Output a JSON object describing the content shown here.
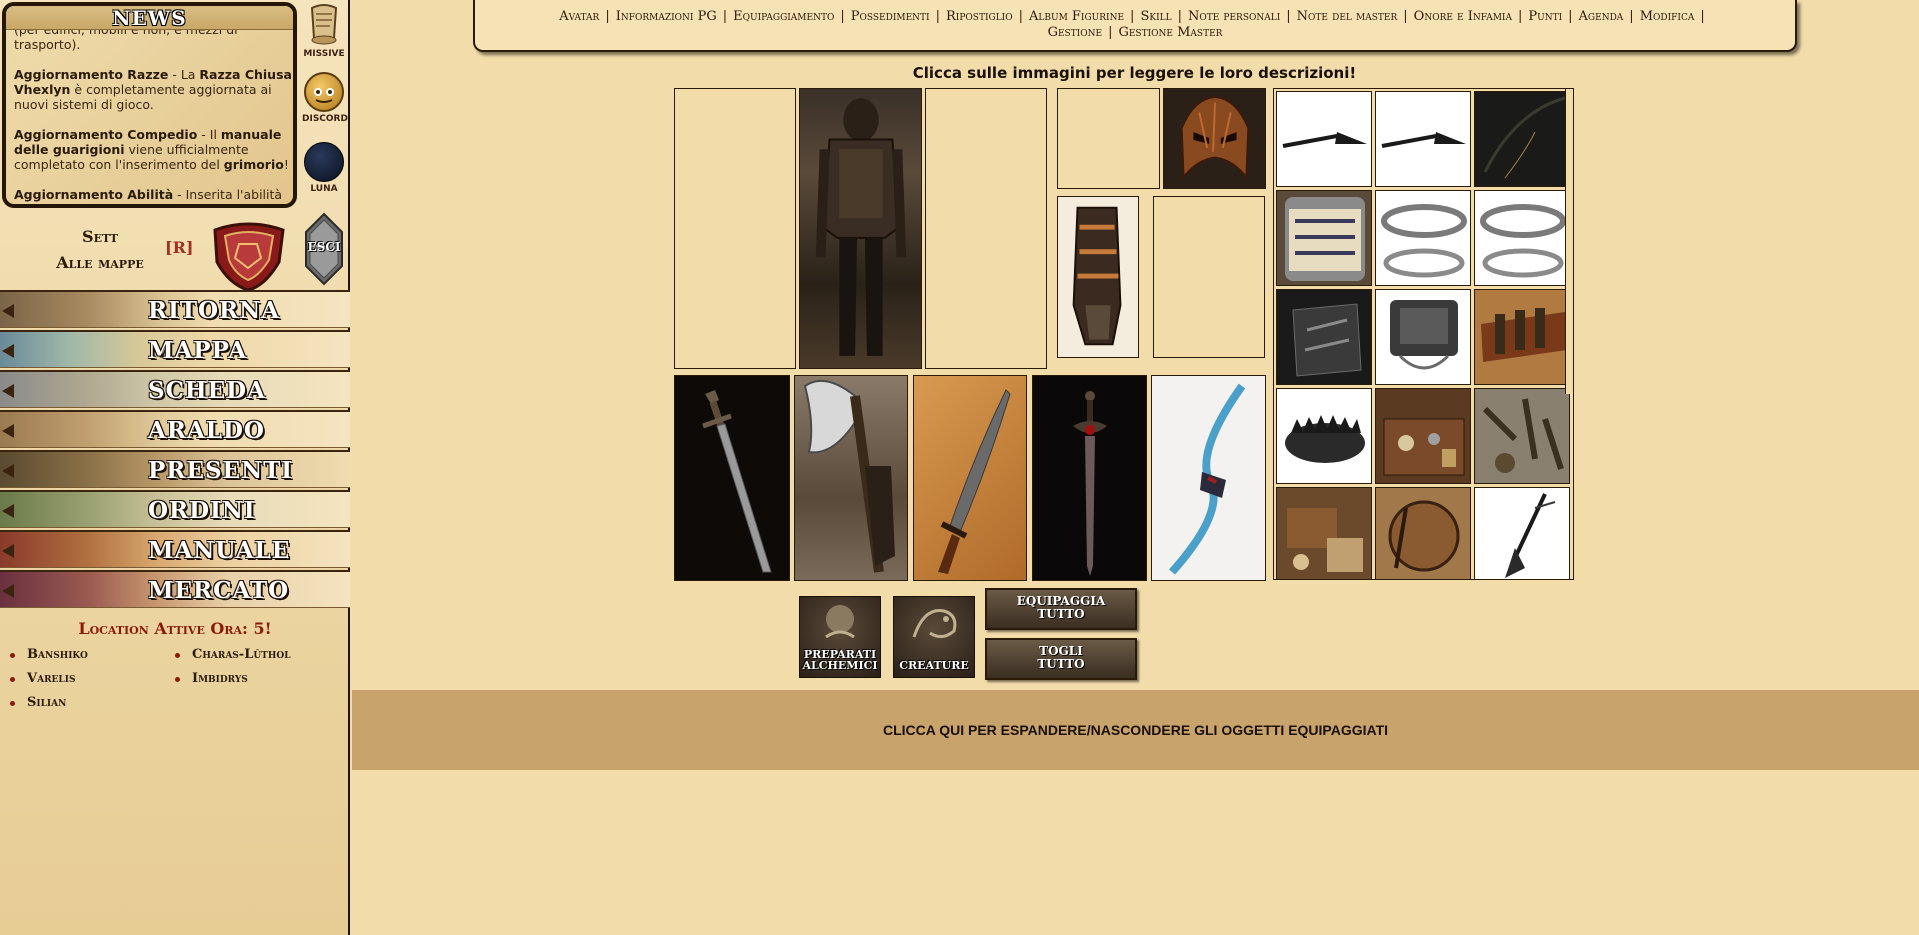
{
  "news": {
    "title": "NEWS",
    "items": [
      {
        "lead": "",
        "text": "(per edifici, mobili e non, e mezzi di trasporto)."
      },
      {
        "lead": "Aggiornamento Razze",
        "text": " - La ",
        "bold2": "Razza Chiusa Vhexlyn",
        "text2": " è completamente aggiornata ai nuovi sistemi di gioco."
      },
      {
        "lead": "Aggiornamento Compedio",
        "text": " - Il ",
        "bold2": "manuale delle guarigioni",
        "text2": " viene ufficialmente completato con l'inserimento del ",
        "bold3": "grimorio",
        "text3": "!"
      },
      {
        "lead": "Aggiornamento Abilità",
        "text": " - Inserita l'abilità"
      }
    ]
  },
  "side_icons": {
    "missive": "MISSIVE",
    "discord": "DISCORD",
    "luna": "LUNA",
    "esci": "ESCI"
  },
  "sett": {
    "line1": "Sett",
    "line2": "Alle mappe",
    "badge": "[R]"
  },
  "nav": [
    "RITORNA",
    "MAPPA",
    "SCHEDA",
    "ARALDO",
    "PRESENTI",
    "ORDINI",
    "MANUALE",
    "MERCATO"
  ],
  "locations": {
    "title": "Location Attive Ora: 5!",
    "items": [
      "Banshiko",
      "Charas-Lûthol",
      "Varelis",
      "Imbidrys",
      "Silian"
    ]
  },
  "topnav": {
    "links": [
      "Avatar",
      "Informazioni PG",
      "Equipaggiamento",
      "Possedimenti",
      "Ripostiglio",
      "Album Figurine",
      "Skill",
      "Note personali",
      "Note del master",
      "Onore e Infamia",
      "Punti",
      "Agenda",
      "Modifica",
      "Gestione",
      "Gestione Master"
    ]
  },
  "instruction": "Clicca sulle immagini per leggere le loro descrizioni!",
  "buttons": {
    "preparati": "PREPARATI ALCHEMICI",
    "creature": "CREATURE",
    "equipaggia": "EQUIPAGGIA TUTTO",
    "togli": "TOGLI TUTTO"
  },
  "expand_label": "CLICCA QUI PER ESPANDERE/NASCONDERE GLI OGGETTI EQUIPAGGIATI",
  "colors": {
    "bg": "#f2dcaa",
    "border": "#2a1a08",
    "accent_red": "#8a1a08",
    "expand_bar": "#c9a36c"
  }
}
